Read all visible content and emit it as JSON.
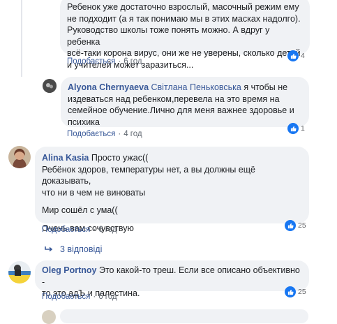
{
  "comments": {
    "c1": {
      "lines": [
        "Ребенок уже достаточно взрослый, масочный режим ему",
        "не подходит (а я так понимаю мы в этих масках надолго).",
        "Руководство школы тоже понять можно. А вдруг у ребенка",
        "всё-таки корона вирус, они же не уверены, сколько детей",
        "и учителей может заразиться..."
      ],
      "like_label": "Подобається",
      "time": "6 год",
      "reactions": "4"
    },
    "c2": {
      "author": "Alyona Chernyaeva",
      "mention": "Світлана Пеньковська",
      "text_first": "я чтобы не",
      "lines": [
        "издеваться над ребенком,перевела на это время на",
        "семейное обучение.Лично для меня важнее здоровье и",
        "психика"
      ],
      "like_label": "Подобається",
      "time": "4 год",
      "reactions": "1"
    },
    "c3": {
      "author": "Alina Kasia",
      "text_first": "Просто ужас((",
      "lines": [
        "Ребёнок здоров, температуры нет, а вы должны ещё доказывать,",
        "что ни в чем не виноваты"
      ],
      "para2": "Мир сошёл с ума((",
      "para3": "Очень вам сочувствую",
      "like_label": "Подобається",
      "time": "6 год",
      "reactions": "25"
    },
    "replies_label": "3 відповіді",
    "c4": {
      "author": "Oleg Portnoy",
      "text_first": "Это какой-то треш. Если все описано объективно -",
      "lines": [
        "то это адЪ и палестина."
      ],
      "like_label": "Подобається",
      "time": "6 год",
      "reactions": "25"
    }
  },
  "colors": {
    "link": "#385898",
    "bubble": "#f0f2f5",
    "like_blue": "#1877f2"
  }
}
